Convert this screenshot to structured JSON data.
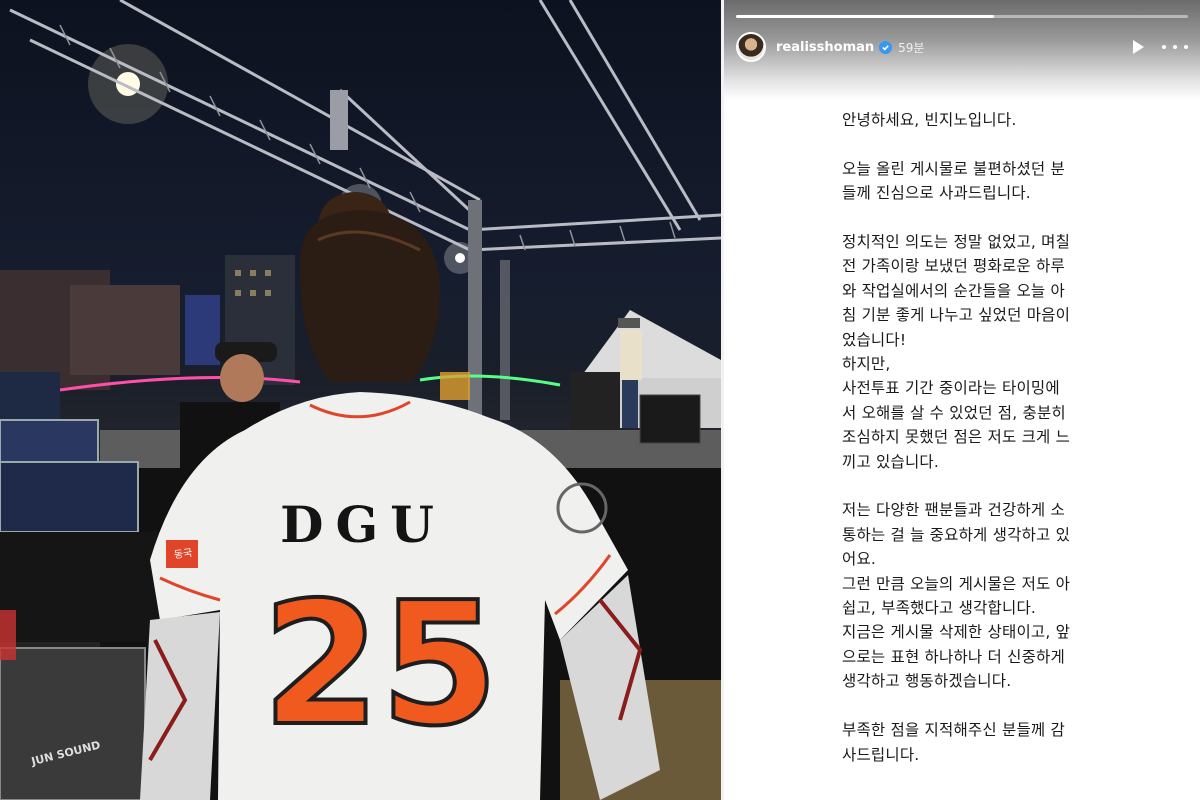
{
  "photo": {
    "jersey_name": "DGU",
    "jersey_number": "25",
    "sleeve_patch": "동국",
    "road_case_label": "JUN SOUND"
  },
  "story": {
    "progress": 0.57,
    "account": {
      "username": "realisshoman",
      "verified": true,
      "time": "59분",
      "avatar_icon": "profile-avatar"
    },
    "controls": {
      "play_icon": "play-icon",
      "more_icon": "more-options-icon"
    },
    "paragraphs": [
      "안녕하세요, 빈지노입니다.",
      "오늘 올린 게시물로 불편하셨던 분\n들께 진심으로 사과드립니다.",
      "정치적인 의도는 정말 없었고, 며칠\n전 가족이랑 보냈던 평화로운 하루\n와 작업실에서의 순간들을 오늘 아\n침 기분 좋게 나누고 싶었던 마음이\n었습니다!\n하지만,\n사전투표 기간 중이라는 타이밍에\n서 오해를 살 수 있었던 점, 충분히\n조심하지 못했던 점은 저도 크게 느\n끼고 있습니다.",
      "저는 다양한 팬분들과 건강하게 소\n통하는 걸 늘 중요하게 생각하고 있\n어요.\n그런 만큼 오늘의 게시물은 저도 아\n쉽고, 부족했다고 생각합니다.\n지금은 게시물 삭제한 상태이고, 앞\n으로는 표현 하나하나 더 신중하게\n생각하고 행동하겠습니다.",
      "부족한 점을 지적해주신 분들께 감\n사드립니다."
    ]
  }
}
